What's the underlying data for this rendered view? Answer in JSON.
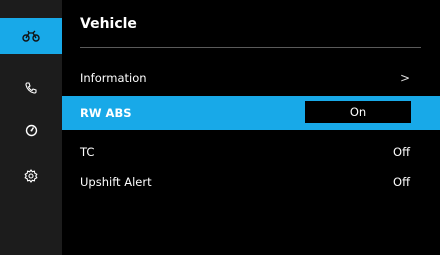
{
  "header": {
    "title": "Vehicle"
  },
  "sidebar": {
    "items": [
      {
        "icon": "motorcycle-icon",
        "active": true
      },
      {
        "icon": "phone-icon",
        "active": false
      },
      {
        "icon": "gauge-icon",
        "active": false
      },
      {
        "icon": "gear-icon",
        "active": false
      }
    ]
  },
  "menu": {
    "rows": [
      {
        "label": "Information",
        "value": ">"
      },
      {
        "label": "RW ABS",
        "value": "On"
      },
      {
        "label": "TC",
        "value": "Off"
      },
      {
        "label": "Upshift Alert",
        "value": "Off"
      }
    ]
  },
  "colors": {
    "accent": "#18a9e8",
    "sidebar": "#1c1c1c",
    "background": "#000000"
  }
}
